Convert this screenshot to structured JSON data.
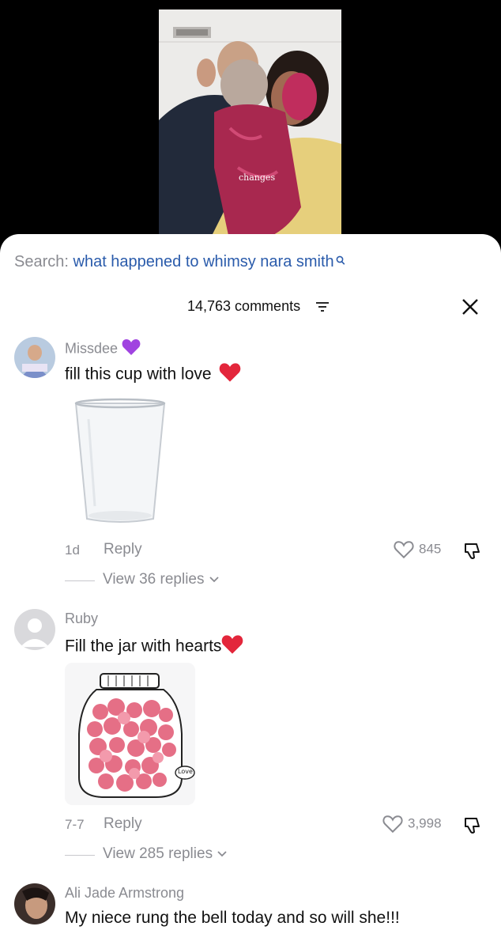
{
  "video": {
    "caption": "changes"
  },
  "search": {
    "label": "Search:",
    "query": "what happened to whimsy nara smith"
  },
  "comments_header": {
    "count": "14,763 comments"
  },
  "comments": [
    {
      "username": "Missdee",
      "text": "fill this cup with love",
      "time": "1d",
      "reply": "Reply",
      "likes": "845",
      "view_replies": "View 36 replies"
    },
    {
      "username": "Ruby",
      "text": "Fill the jar with hearts",
      "time": "7-7",
      "reply": "Reply",
      "likes": "3,998",
      "view_replies": "View 285 replies",
      "image_label": "Love"
    },
    {
      "username": "Ali Jade Armstrong",
      "text": "My niece rung the bell today and so will she!!!"
    }
  ],
  "colors": {
    "link_blue": "#2a5bab",
    "muted": "#8a8b91",
    "heart_red": "#e3263b",
    "purple_heart": "#a043e0"
  }
}
